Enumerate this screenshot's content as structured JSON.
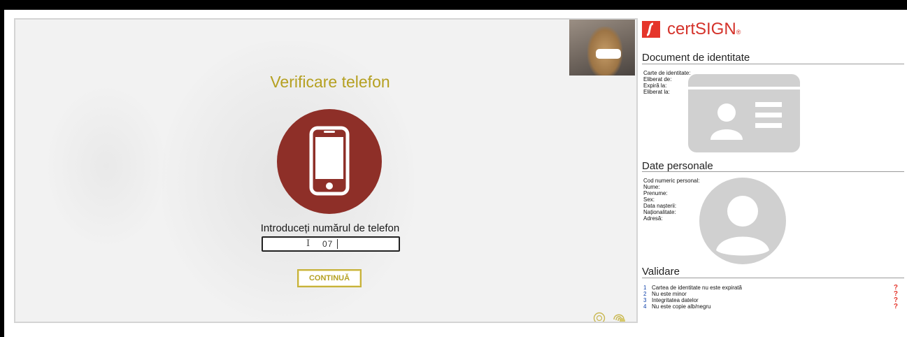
{
  "verification": {
    "title": "Verificare telefon",
    "phone_label": "Introduceți numărul de telefon",
    "phone_value": "07",
    "continue_label": "CONTINUĂ"
  },
  "brand": {
    "name": "certSIGN",
    "registered": "®",
    "color": "#e5352b"
  },
  "identity_document": {
    "title": "Document de identitate",
    "fields": [
      "Carte de identitate:",
      "Eliberat de:",
      "Expiră la:",
      "Eliberat la:"
    ]
  },
  "personal_data": {
    "title": "Date personale",
    "fields": [
      "Cod numeric personal:",
      "Nume:",
      "Prenume:",
      "Sex:",
      "Data nașterii:",
      "Naționalitate:",
      "Adresă:"
    ]
  },
  "validation": {
    "title": "Validare",
    "items": [
      {
        "num": "1",
        "label": "Cartea de identitate nu este expirată",
        "status": "?"
      },
      {
        "num": "2",
        "label": "Nu este minor",
        "status": "?"
      },
      {
        "num": "3",
        "label": "Integritatea datelor",
        "status": "?"
      },
      {
        "num": "4",
        "label": "Nu este copie alb/negru",
        "status": "?"
      }
    ]
  },
  "icons": {
    "phone": "smartphone-icon",
    "id_card": "id-card-icon",
    "person": "user-avatar-icon",
    "footer": [
      "settings-circle-icon",
      "fingerprint-icon"
    ]
  },
  "colors": {
    "accent_gold": "#b5a021",
    "phone_circle": "#8e2f28",
    "status_red": "#e5352b",
    "placeholder_gray": "#d0d0d0"
  }
}
